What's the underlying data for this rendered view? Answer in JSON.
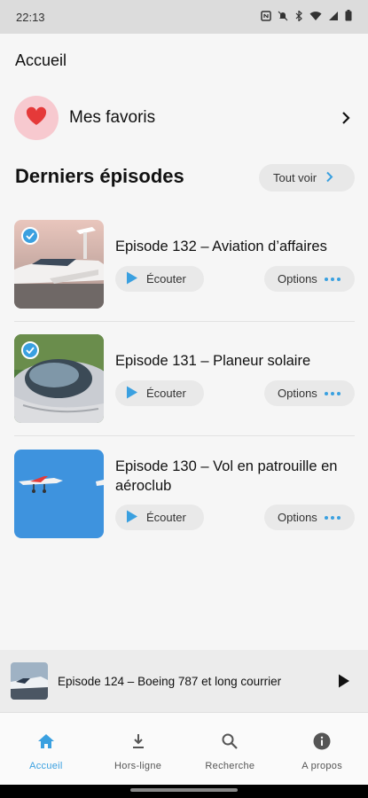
{
  "status": {
    "time": "22:13"
  },
  "header": {
    "title": "Accueil"
  },
  "favorites": {
    "label": "Mes favoris",
    "icon": "heart-icon",
    "color": "#f7c9cf"
  },
  "latest": {
    "title": "Derniers épisodes",
    "see_all": "Tout voir"
  },
  "episodes": [
    {
      "title": "Episode 132 – Aviation d’affaires",
      "listen": "Écouter",
      "options": "Options",
      "downloaded": true
    },
    {
      "title": "Episode 131 – Planeur solaire",
      "listen": "Écouter",
      "options": "Options",
      "downloaded": true
    },
    {
      "title": "Episode 130 – Vol en patrouille en aéroclub",
      "listen": "Écouter",
      "options": "Options",
      "downloaded": false
    }
  ],
  "player": {
    "title": "Episode 124 – Boeing 787 et long courrier"
  },
  "nav": [
    {
      "label": "Accueil",
      "icon": "home-icon",
      "active": true
    },
    {
      "label": "Hors-ligne",
      "icon": "download-icon",
      "active": false
    },
    {
      "label": "Recherche",
      "icon": "search-icon",
      "active": false
    },
    {
      "label": "A propos",
      "icon": "info-icon",
      "active": false
    }
  ],
  "colors": {
    "accent": "#3aa0e0",
    "background": "#f6f6f6"
  }
}
